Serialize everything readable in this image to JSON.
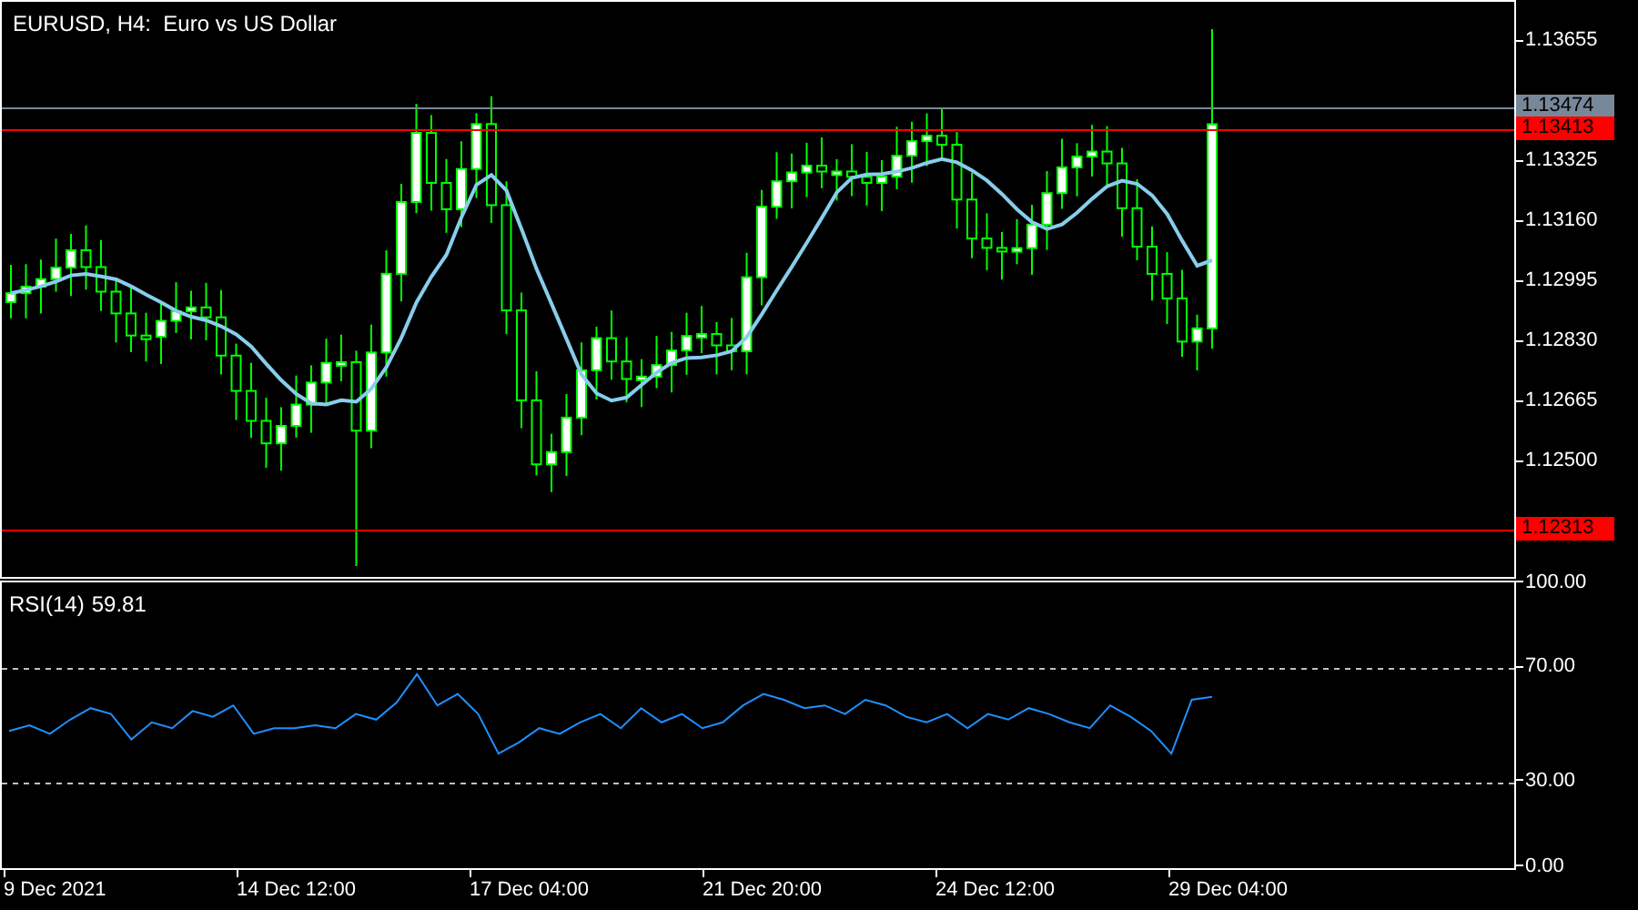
{
  "chart_title": "EURUSD, H4:  Euro vs US Dollar",
  "price_axis": {
    "ticks": [
      "1.13655",
      "1.13325",
      "1.13160",
      "1.12995",
      "1.12830",
      "1.12665",
      "1.12500"
    ]
  },
  "price_lines": [
    {
      "label": "1.13474",
      "color": "#778899"
    },
    {
      "label": "1.13413",
      "color": "#ff0000"
    },
    {
      "label": "1.12313",
      "color": "#ff0000"
    }
  ],
  "rsi_panel": {
    "value": "59.81",
    "chart_data": {
      "type": "line",
      "ylim": [
        0,
        100
      ],
      "yticks": [
        {
          "value": 100,
          "label": "100.00"
        },
        {
          "value": 70,
          "label": "70.00"
        },
        {
          "value": 30,
          "label": "30.00"
        },
        {
          "value": 0,
          "label": "0.00"
        }
      ],
      "series": [
        {
          "name": "RSI(14)",
          "color": "#1e90ff",
          "values": [
            48,
            50,
            47,
            52,
            56,
            54,
            45,
            51,
            49,
            55,
            53,
            57,
            47,
            49,
            49,
            50,
            49,
            54,
            52,
            58,
            68,
            57,
            61,
            54,
            40,
            44,
            49,
            47,
            51,
            54,
            49,
            56,
            51,
            54,
            49,
            51,
            57,
            61,
            59,
            56,
            57,
            54,
            59,
            57,
            53,
            51,
            54,
            49,
            54,
            52,
            56,
            54,
            51,
            49,
            57,
            53,
            48,
            40,
            59,
            60
          ]
        }
      ]
    }
  },
  "time_axis": {
    "labels": [
      "9 Dec 2021",
      "14 Dec 12:00",
      "17 Dec 04:00",
      "21 Dec 20:00",
      "24 Dec 12:00",
      "29 Dec 04:00"
    ]
  }
}
